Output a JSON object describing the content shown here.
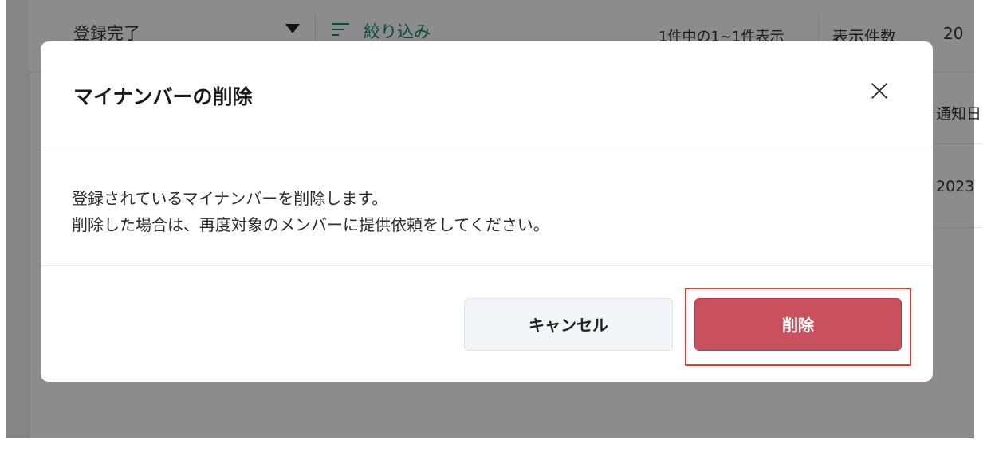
{
  "background": {
    "status_select": "登録完了",
    "filter_label": "絞り込み",
    "result_count": "1件中の1~1件表示",
    "per_page_label": "表示件数",
    "per_page_value": "20",
    "column_header": "通知日",
    "row_date": "2023"
  },
  "modal": {
    "title": "マイナンバーの削除",
    "body_line1": "登録されているマイナンバーを削除します。",
    "body_line2": "削除した場合は、再度対象のメンバーに提供依頼をしてください。",
    "cancel_label": "キャンセル",
    "delete_label": "削除",
    "delete_color": "#c9515e",
    "highlight_color": "#e33a2d"
  }
}
